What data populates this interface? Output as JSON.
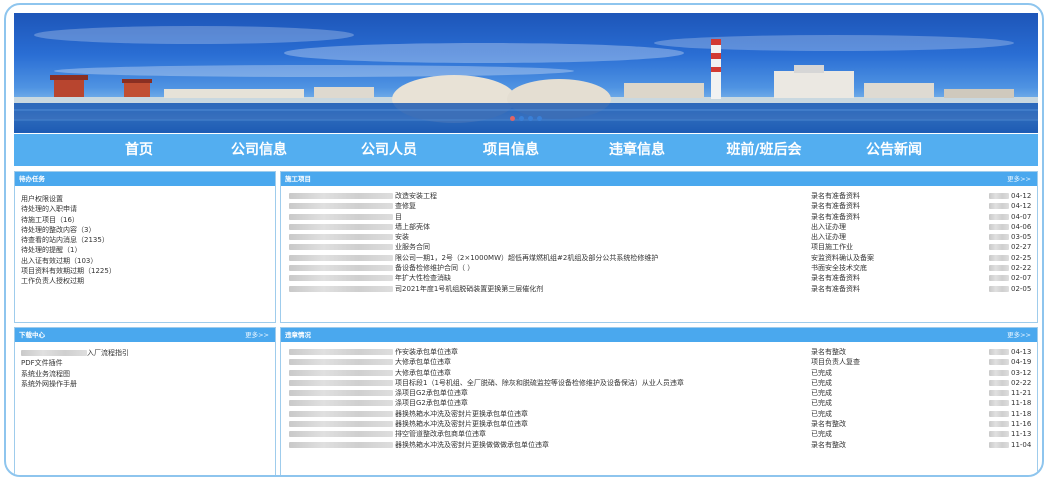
{
  "nav": [
    {
      "label": "首页"
    },
    {
      "label": "公司信息"
    },
    {
      "label": "公司人员"
    },
    {
      "label": "项目信息"
    },
    {
      "label": "违章信息"
    },
    {
      "label": "班前/班后会"
    },
    {
      "label": "公告新闻"
    }
  ],
  "todo": {
    "title": "待办任务",
    "items": [
      "用户权限设置",
      "待处理的入职申请",
      "待施工项目（16）",
      "待处理的整改内容（3）",
      "待查看的站内消息（2135）",
      "待处理的提醒（1）",
      "出入证有效过期（103）",
      "项目资料有效期过期（1225）",
      "工作负责人授权过期"
    ]
  },
  "download": {
    "title": "下载中心",
    "more": "更多>>",
    "items": [
      {
        "redacted": true,
        "text": "入厂流程指引"
      },
      {
        "redacted": false,
        "text": "PDF文件插件"
      },
      {
        "redacted": false,
        "text": "系统业务流程图"
      },
      {
        "redacted": false,
        "text": "系统外网操作手册"
      }
    ]
  },
  "projects": {
    "title": "施工项目",
    "more": "更多>>",
    "rows": [
      {
        "title": "改造安装工程",
        "status": "录名有准备资料",
        "date": "04-12"
      },
      {
        "title": "查修复",
        "status": "录名有准备资料",
        "date": "04-12"
      },
      {
        "title": "目",
        "status": "录名有准备资料",
        "date": "04-07"
      },
      {
        "title": "墙上部壳体",
        "status": "出入证办理",
        "date": "04-06"
      },
      {
        "title": "安装",
        "status": "出入证办理",
        "date": "03-05"
      },
      {
        "title": "业服务合同",
        "status": "项目施工作业",
        "date": "02-27"
      },
      {
        "title": "限公司一期1，2号（2×1000MW）超低再煤燃机组#2机组及部分公共系统检修维护",
        "status": "安监资料确认及备案",
        "date": "02-25"
      },
      {
        "title": "备设备检修维护合同（                   ）",
        "status": "书面安全技术交底",
        "date": "02-22"
      },
      {
        "title": "年扩大性检查消缺",
        "status": "录名有准备资料",
        "date": "02-07"
      },
      {
        "title": "司2021年度1号机组脱硝装置更换第三层催化剂",
        "status": "录名有准备资料",
        "date": "02-05"
      }
    ]
  },
  "violations": {
    "title": "违章情况",
    "more": "更多>>",
    "rows": [
      {
        "title": "作安装承包单位违章",
        "status": "录名有整改",
        "date": "04-13"
      },
      {
        "title": "大修承包单位违章",
        "status": "项目负责人复查",
        "date": "04-19"
      },
      {
        "title": "大修承包单位违章",
        "status": "已完成",
        "date": "03-12"
      },
      {
        "title": "项目标段1（1号机组、全厂脱硝、除灰和脱硫监控等设备检修维护及设备保洁）从业人员违章",
        "status": "已完成",
        "date": "02-22"
      },
      {
        "title": "涤项目G2承包单位违章",
        "status": "已完成",
        "date": "11-21"
      },
      {
        "title": "涤项目G2承包单位违章",
        "status": "已完成",
        "date": "11-18"
      },
      {
        "title": "器换热箱水冲洗及密封片更换承包单位违章",
        "status": "已完成",
        "date": "11-18"
      },
      {
        "title": "器换热箱水冲洗及密封片更换承包单位违章",
        "status": "录名有整改",
        "date": "11-16"
      },
      {
        "title": "排空管道整改承包商单位违章",
        "status": "已完成",
        "date": "11-13"
      },
      {
        "title": "器换热箱水冲洗及密封片更换做做做承包单位违章",
        "status": "录名有整改",
        "date": "11-04"
      }
    ]
  },
  "colors": {
    "nav_bg": "#53aef0",
    "panel_head": "#4aa8ee",
    "frame_border": "#8ec5ee"
  }
}
